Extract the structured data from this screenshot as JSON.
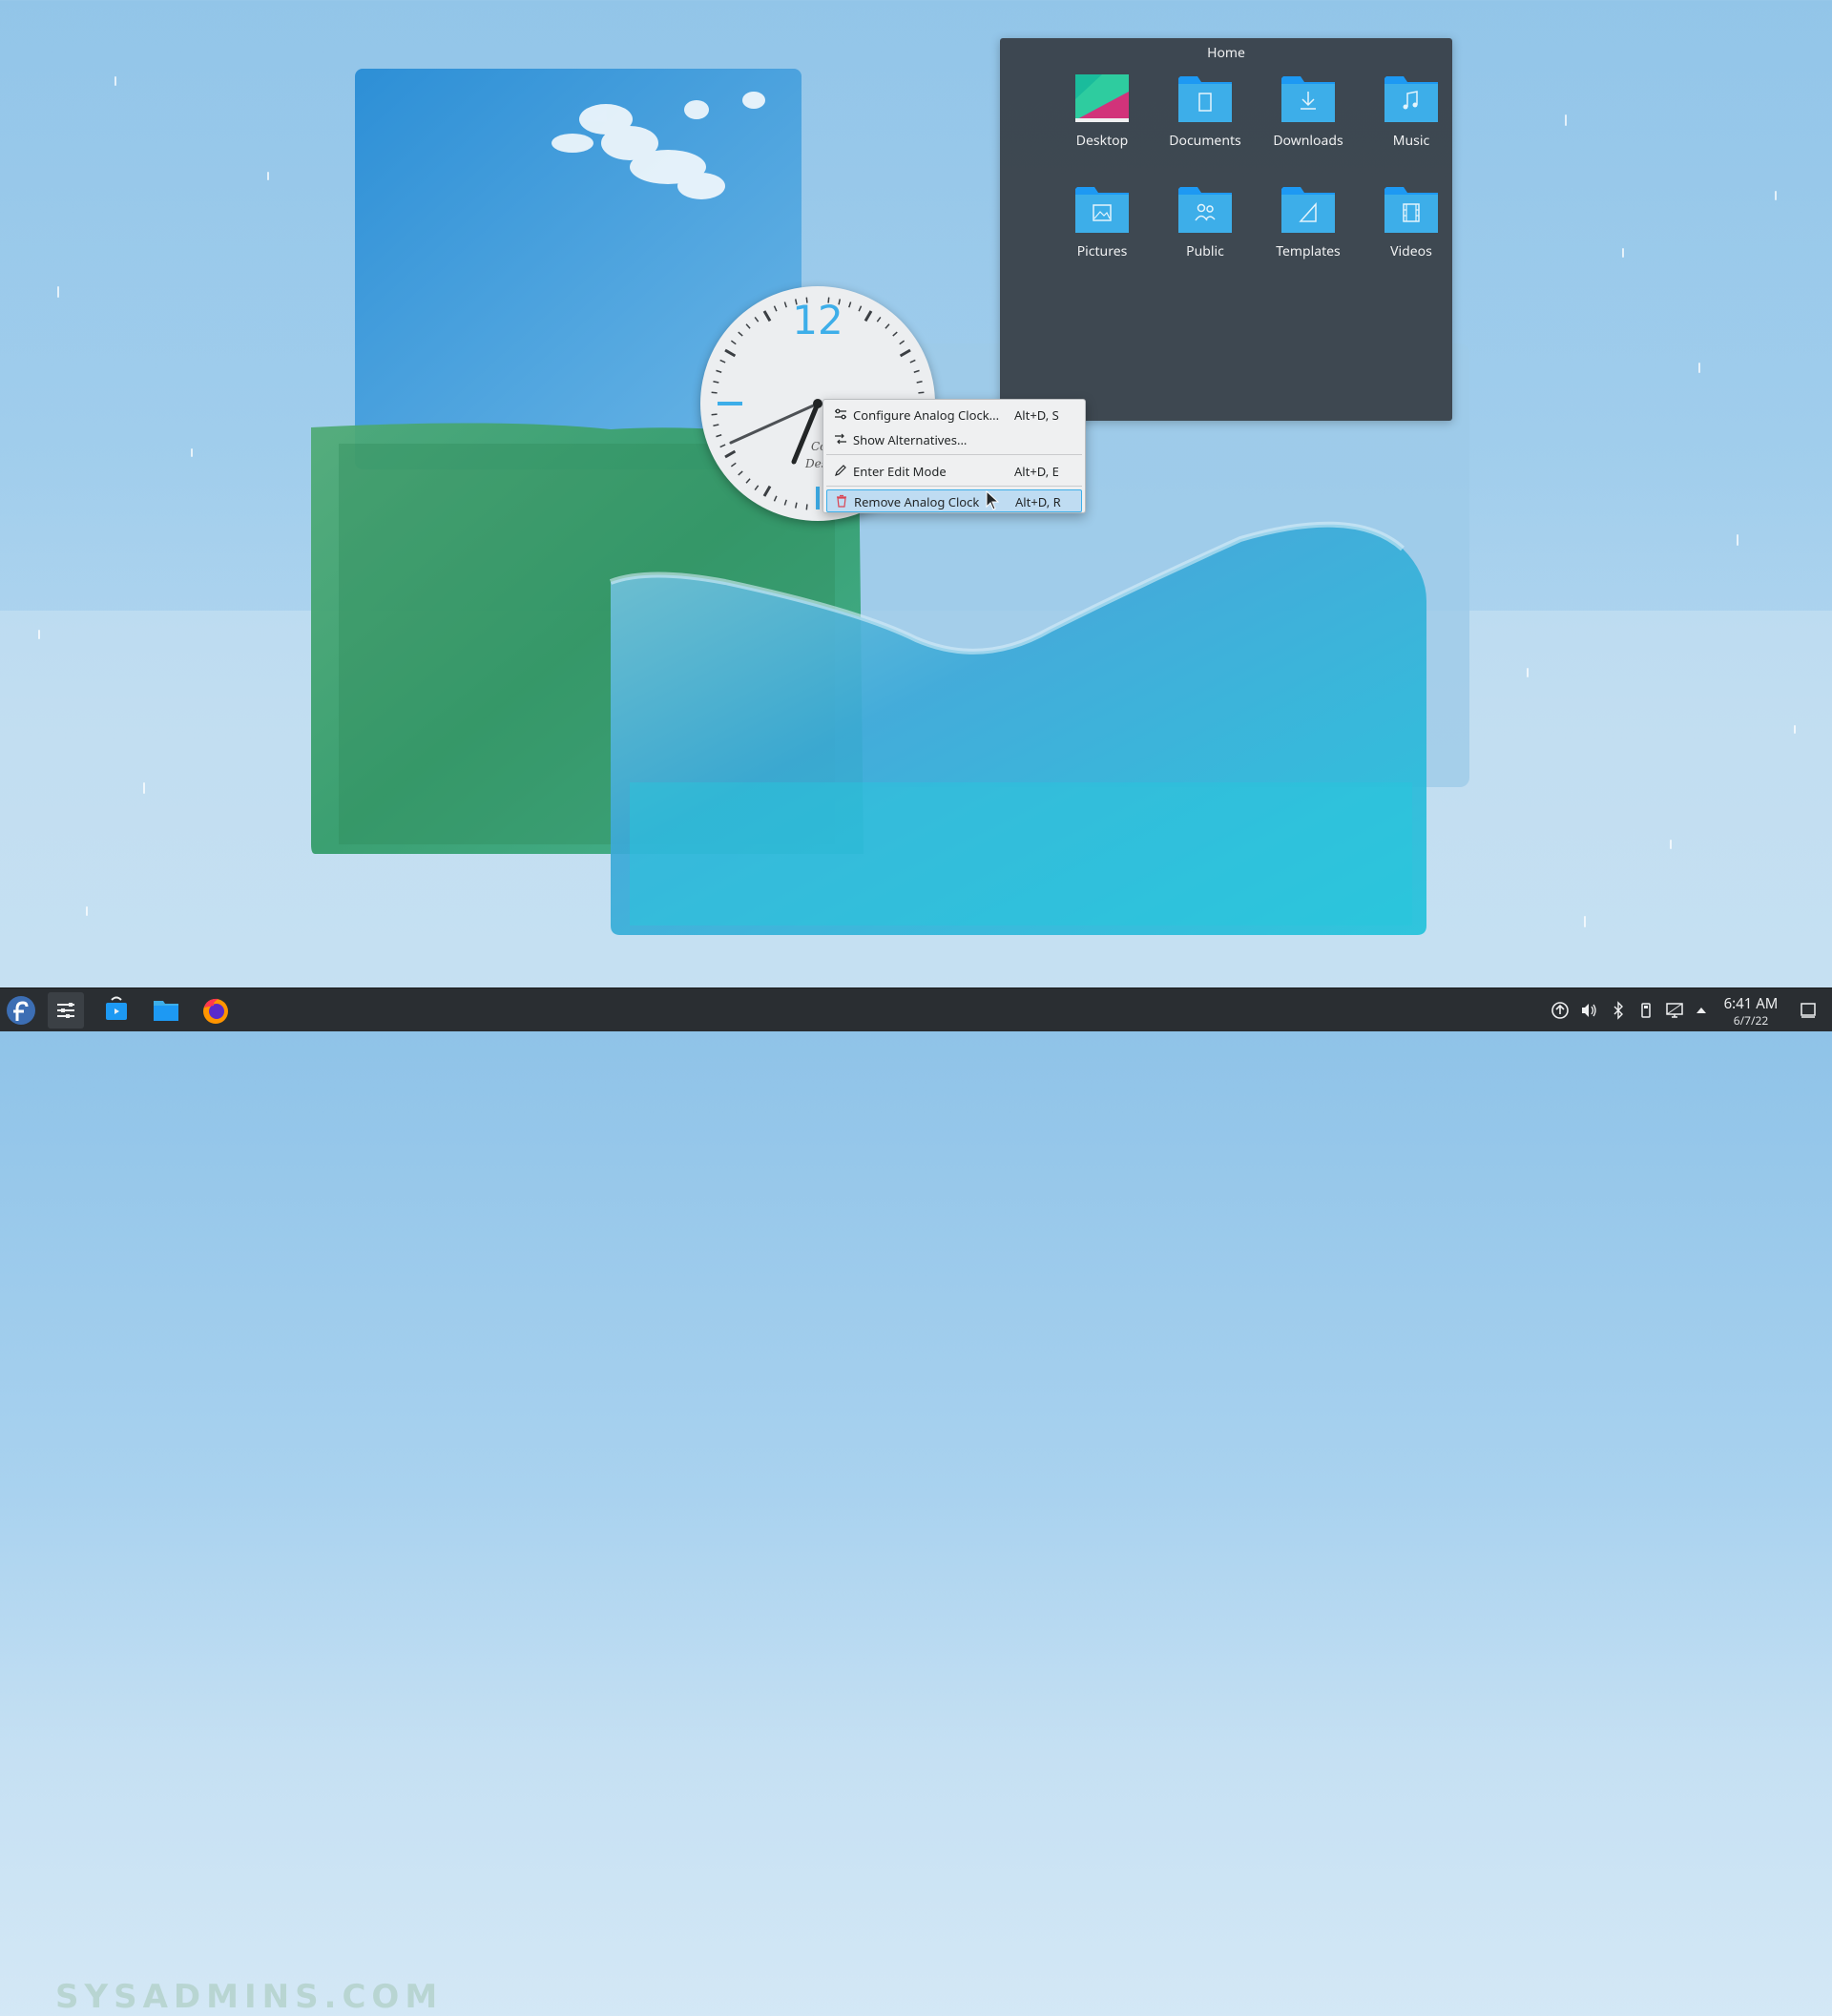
{
  "folder_view": {
    "title": "Home",
    "items": [
      {
        "label": "Desktop",
        "icon": "desktop-folder-icon"
      },
      {
        "label": "Documents",
        "icon": "documents-folder-icon"
      },
      {
        "label": "Downloads",
        "icon": "downloads-folder-icon"
      },
      {
        "label": "Music",
        "icon": "music-folder-icon"
      },
      {
        "label": "Pictures",
        "icon": "pictures-folder-icon"
      },
      {
        "label": "Public",
        "icon": "public-folder-icon"
      },
      {
        "label": "Templates",
        "icon": "templates-folder-icon"
      },
      {
        "label": "Videos",
        "icon": "videos-folder-icon"
      }
    ]
  },
  "clock_widget": {
    "numeral": "12",
    "face_text": [
      "Comm",
      "Desi"
    ]
  },
  "context_menu": {
    "items": [
      {
        "label": "Configure Analog Clock...",
        "shortcut": "Alt+D, S",
        "icon": "configure-icon"
      },
      {
        "label": "Show Alternatives...",
        "shortcut": "",
        "icon": "alternatives-icon"
      },
      {
        "label": "Enter Edit Mode",
        "shortcut": "Alt+D, E",
        "icon": "edit-icon"
      },
      {
        "label": "Remove Analog Clock",
        "shortcut": "Alt+D, R",
        "icon": "trash-icon",
        "highlighted": true
      }
    ]
  },
  "taskbar": {
    "watermark": "SYSADMINS.COM",
    "time": "6:41 AM",
    "date": "6/7/22"
  },
  "colors": {
    "accent": "#3daee9",
    "panel": "#2a2e32",
    "folder": "#3daee9",
    "menu_bg": "#eff0f1",
    "highlight": "#bfdcf2"
  }
}
